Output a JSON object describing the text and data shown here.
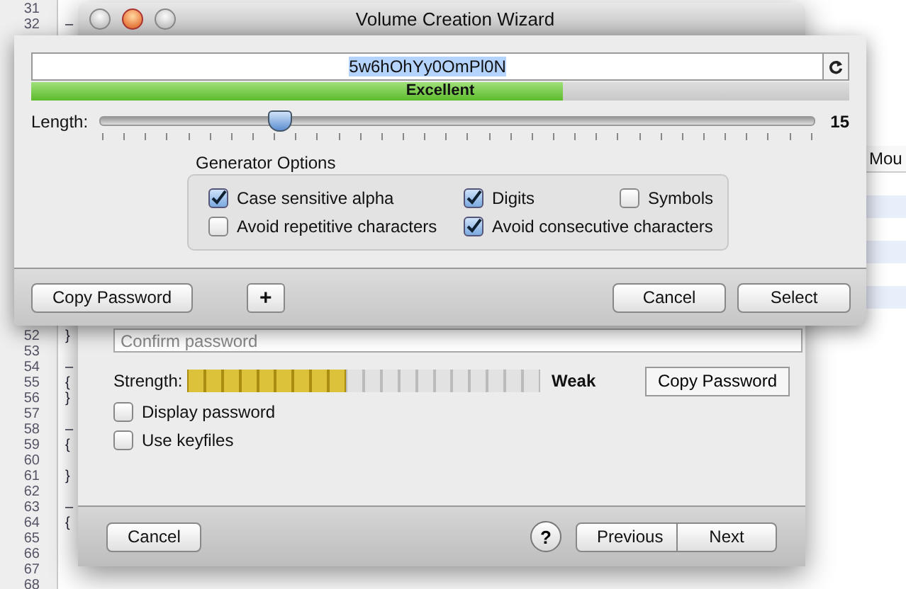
{
  "editor": {
    "line_groups": [
      [
        {
          "number": "31"
        },
        {
          "number": "32",
          "fold": "–"
        }
      ],
      [
        {
          "number": "52",
          "fold": "}"
        },
        {
          "number": "53"
        },
        {
          "number": "54",
          "fold": "–"
        },
        {
          "number": "55",
          "fold": "{"
        },
        {
          "number": "56",
          "fold": "}"
        },
        {
          "number": "57"
        },
        {
          "number": "58",
          "fold": "–"
        },
        {
          "number": "59",
          "fold": "{"
        },
        {
          "number": "60"
        },
        {
          "number": "61",
          "fold": "}"
        },
        {
          "number": "62"
        },
        {
          "number": "63",
          "fold": "–"
        },
        {
          "number": "64",
          "fold": "{"
        },
        {
          "number": "65"
        },
        {
          "number": "66"
        },
        {
          "number": "67"
        },
        {
          "number": "68"
        }
      ]
    ]
  },
  "table": {
    "columns": [
      "Mou"
    ]
  },
  "window": {
    "title": "Volume Creation Wizard",
    "confirm": {
      "placeholder": "Confirm password"
    },
    "strength": {
      "label": "Strength:",
      "level": 0.45,
      "reading": "Weak"
    },
    "copy_button": "Copy Password",
    "checkboxes": [
      {
        "label": "Display password",
        "checked": false
      },
      {
        "label": "Use keyfiles",
        "checked": false
      }
    ],
    "footer": {
      "cancel": "Cancel",
      "help": "?",
      "previous": "Previous",
      "next": "Next"
    }
  },
  "generator": {
    "password": "5w6hOhYy0OmPl0N",
    "quality": {
      "label": "Excellent",
      "level": 0.65
    },
    "length": {
      "label": "Length:",
      "level": 0.25,
      "value": "15"
    },
    "options": {
      "title": "Generator Options",
      "items": [
        {
          "label": "Case sensitive alpha",
          "checked": true
        },
        {
          "label": "Digits",
          "checked": true
        },
        {
          "label": "Symbols",
          "checked": false
        },
        {
          "label": "Avoid repetitive characters",
          "checked": false
        },
        {
          "label": "Avoid consecutive characters",
          "checked": true
        }
      ]
    },
    "copy_button": "Copy Password",
    "add_button": "+",
    "cancel": "Cancel",
    "select": "Select"
  }
}
